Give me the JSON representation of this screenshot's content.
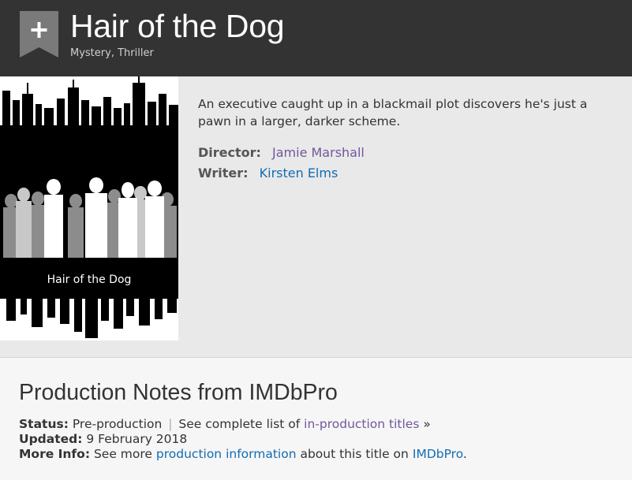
{
  "header": {
    "title": "Hair of the Dog",
    "genres": "Mystery, Thriller",
    "watchlist_icon": "plus-ribbon-icon"
  },
  "poster": {
    "caption": "Hair of the Dog"
  },
  "overview": {
    "plot": "An executive caught up in a blackmail plot discovers he's just a pawn in a larger, darker scheme.",
    "director_label": "Director:",
    "director": "Jamie Marshall",
    "writer_label": "Writer:",
    "writer": "Kirsten Elms"
  },
  "production": {
    "heading": "Production Notes from IMDbPro",
    "status_label": "Status:",
    "status_value": "Pre-production",
    "separator": "|",
    "see_list_text": "See complete list of",
    "in_production_link": "in-production titles",
    "raquo": "»",
    "updated_label": "Updated:",
    "updated_value": "9 February 2018",
    "more_info_label": "More Info:",
    "see_more_text": "See more",
    "production_info_link": "production information",
    "about_text": "about this title on",
    "imdbpro_link": "IMDbPro",
    "period": "."
  },
  "colors": {
    "header_bg": "#333333",
    "link": "#136cb2",
    "visited_link": "#70579d"
  }
}
